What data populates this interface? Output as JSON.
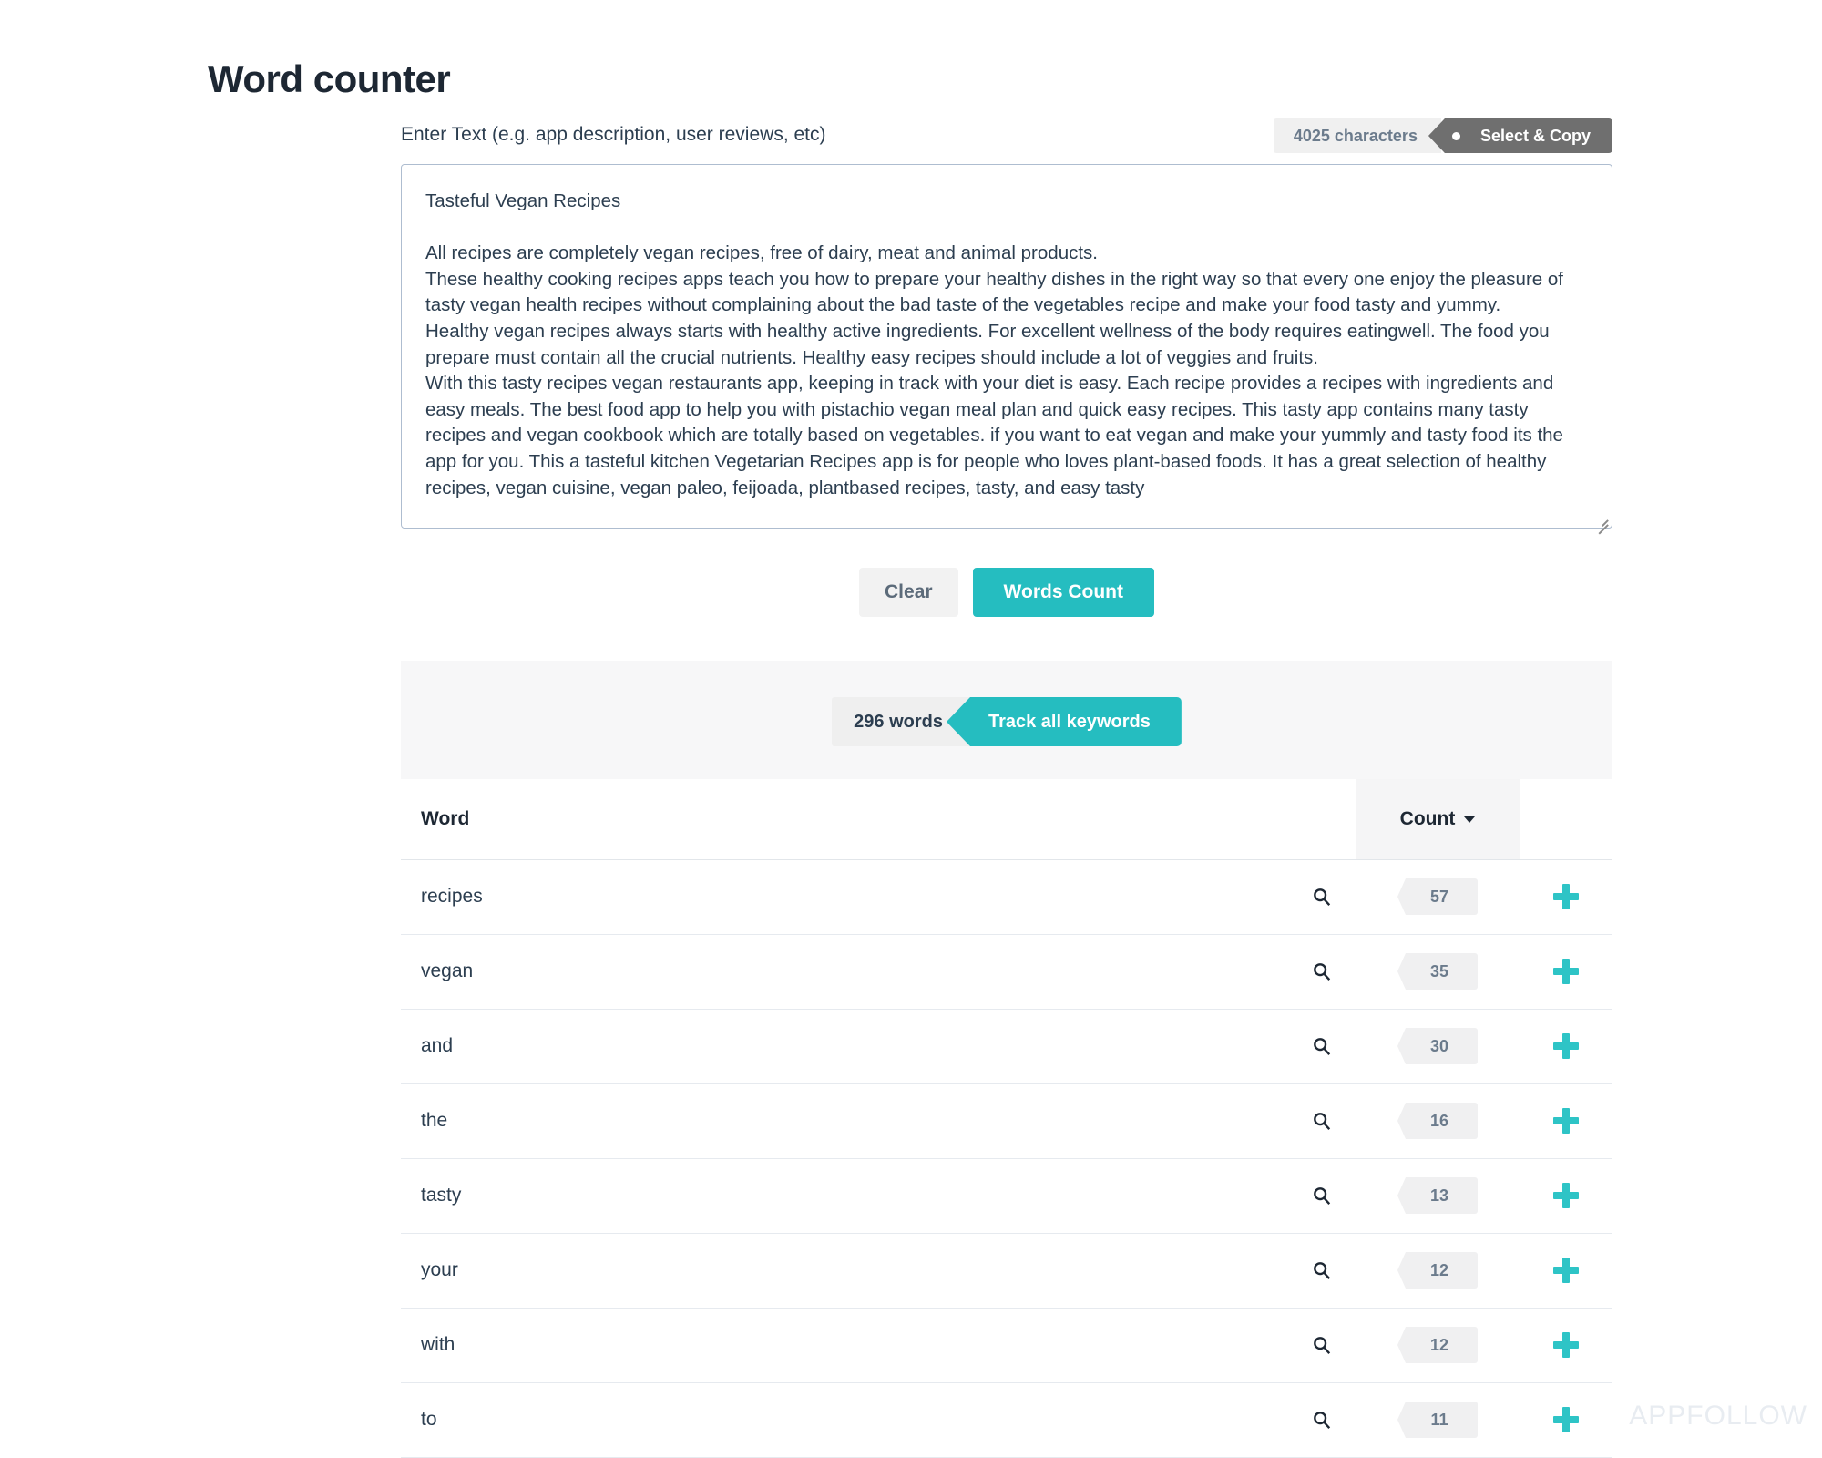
{
  "page": {
    "title": "Word counter",
    "watermark": "APPFOLLOW"
  },
  "input": {
    "label": "Enter Text (e.g. app description, user reviews, etc)",
    "char_badge": "4025 characters",
    "select_copy_label": "Select & Copy",
    "placeholder": "Enter Text (e.g. app description, user reviews, etc)",
    "value": "Tasteful Vegan Recipes\n\nAll recipes are completely vegan recipes, free of dairy, meat and animal products.\nThese healthy cooking recipes apps teach you how to prepare your healthy dishes in the right way so that every one enjoy the pleasure of tasty vegan health recipes without complaining about the bad taste of the vegetables recipe and make your food tasty and yummy.\nHealthy vegan recipes always starts with healthy active ingredients. For excellent wellness of the body requires eatingwell. The food you prepare must contain all the crucial nutrients. Healthy easy recipes should include a lot of veggies and fruits.\nWith this tasty recipes vegan restaurants app, keeping in track with your diet is easy. Each recipe provides a recipes with ingredients and easy meals. The best food app to help you with pistachio vegan meal plan and quick easy recipes. This tasty app contains many tasty recipes and vegan cookbook which are totally based on vegetables. if you want to eat vegan and make your yummly and tasty food its the app for you. This a tasteful kitchen Vegetarian Recipes app is for people who loves plant-based foods. It has a great selection of healthy recipes, vegan cuisine, vegan paleo, feijoada, plantbased recipes, tasty, and easy tasty"
  },
  "actions": {
    "clear_label": "Clear",
    "count_label": "Words Count"
  },
  "results": {
    "words_badge": "296 words",
    "track_label": "Track all keywords",
    "columns": {
      "word": "Word",
      "count": "Count"
    },
    "rows": [
      {
        "word": "recipes",
        "count": "57"
      },
      {
        "word": "vegan",
        "count": "35"
      },
      {
        "word": "and",
        "count": "30"
      },
      {
        "word": "the",
        "count": "16"
      },
      {
        "word": "tasty",
        "count": "13"
      },
      {
        "word": "your",
        "count": "12"
      },
      {
        "word": "with",
        "count": "12"
      },
      {
        "word": "to",
        "count": "11"
      }
    ]
  },
  "colors": {
    "accent_teal": "#25bdc0",
    "plus_teal": "#2ec4c6",
    "select_copy_gray": "#6f6f6f",
    "text_dark": "#2c3e50"
  },
  "icons": {
    "search": "search-icon",
    "add": "plus-icon",
    "sort": "chevron-down-icon"
  }
}
